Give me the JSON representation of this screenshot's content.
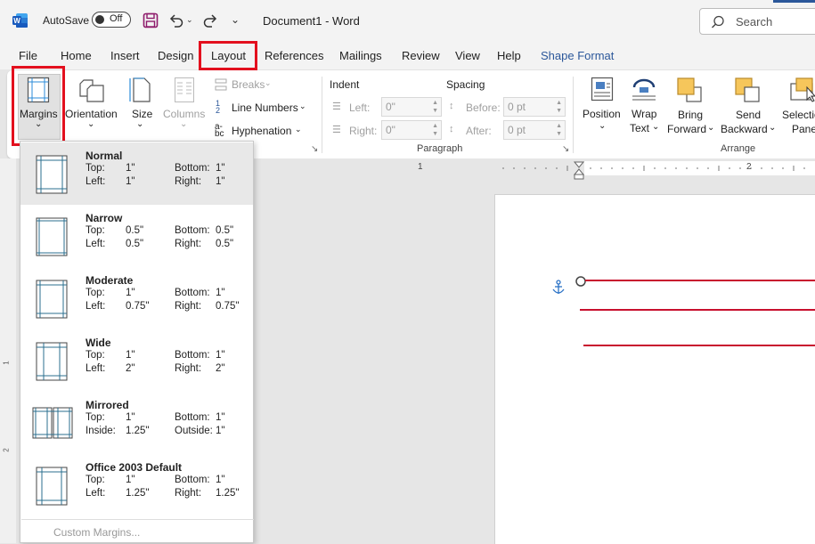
{
  "titlebar": {
    "autosave_label": "AutoSave",
    "autosave_state": "Off",
    "doc_title": "Document1  -  Word",
    "search_placeholder": "Search"
  },
  "tabs": [
    {
      "label": "File"
    },
    {
      "label": "Home"
    },
    {
      "label": "Insert"
    },
    {
      "label": "Design"
    },
    {
      "label": "Layout",
      "active": true
    },
    {
      "label": "References"
    },
    {
      "label": "Mailings"
    },
    {
      "label": "Review"
    },
    {
      "label": "View"
    },
    {
      "label": "Help"
    },
    {
      "label": "Shape Format"
    }
  ],
  "ribbon": {
    "margins": "Margins",
    "orientation": "Orientation",
    "size": "Size",
    "columns": "Columns",
    "breaks": "Breaks",
    "line_numbers": "Line Numbers",
    "hyphenation": "Hyphenation",
    "indent": "Indent",
    "spacing": "Spacing",
    "left_label": "Left:",
    "right_label": "Right:",
    "before_label": "Before:",
    "after_label": "After:",
    "left_value": "0\"",
    "right_value": "0\"",
    "before_value": "0 pt",
    "after_value": "0 pt",
    "paragraph_group": "Paragraph",
    "position": "Position",
    "wrap_text_1": "Wrap",
    "wrap_text_2": "Text",
    "bring_forward_1": "Bring",
    "bring_forward_2": "Forward",
    "send_backward_1": "Send",
    "send_backward_2": "Backward",
    "selection_pane_1": "Selection",
    "selection_pane_2": "Pane",
    "arrange_group": "Arrange"
  },
  "ruler": {
    "mark1": "1",
    "mark2": "2"
  },
  "vruler": {
    "mark1": "1",
    "mark2": "2"
  },
  "margins_menu": {
    "options": [
      {
        "name": "Normal",
        "k1": "Top:",
        "v1": "1\"",
        "k2": "Bottom:",
        "v2": "1\"",
        "k3": "Left:",
        "v3": "1\"",
        "k4": "Right:",
        "v4": "1\""
      },
      {
        "name": "Narrow",
        "k1": "Top:",
        "v1": "0.5\"",
        "k2": "Bottom:",
        "v2": "0.5\"",
        "k3": "Left:",
        "v3": "0.5\"",
        "k4": "Right:",
        "v4": "0.5\""
      },
      {
        "name": "Moderate",
        "k1": "Top:",
        "v1": "1\"",
        "k2": "Bottom:",
        "v2": "1\"",
        "k3": "Left:",
        "v3": "0.75\"",
        "k4": "Right:",
        "v4": "0.75\""
      },
      {
        "name": "Wide",
        "k1": "Top:",
        "v1": "1\"",
        "k2": "Bottom:",
        "v2": "1\"",
        "k3": "Left:",
        "v3": "2\"",
        "k4": "Right:",
        "v4": "2\""
      },
      {
        "name": "Mirrored",
        "k1": "Top:",
        "v1": "1\"",
        "k2": "Bottom:",
        "v2": "1\"",
        "k3": "Inside:",
        "v3": "1.25\"",
        "k4": "Outside:",
        "v4": "1\""
      },
      {
        "name": "Office 2003 Default",
        "k1": "Top:",
        "v1": "1\"",
        "k2": "Bottom:",
        "v2": "1\"",
        "k3": "Left:",
        "v3": "1.25\"",
        "k4": "Right:",
        "v4": "1.25\""
      }
    ],
    "custom_margins": "Custom Margins..."
  }
}
